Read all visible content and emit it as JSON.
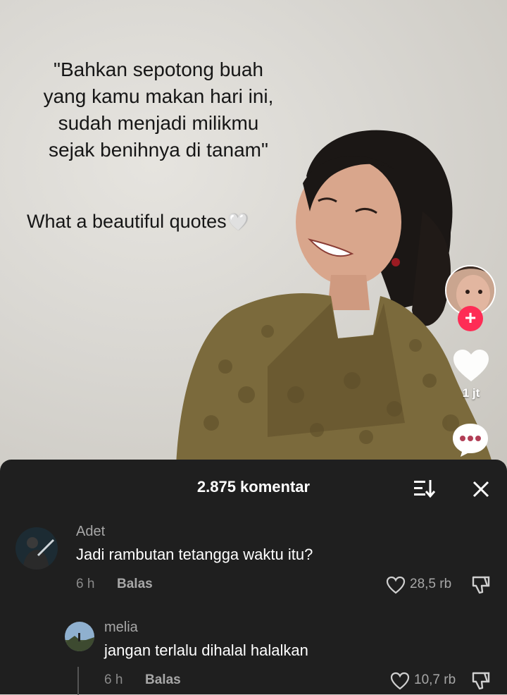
{
  "video": {
    "caption_quote": "\"Bahkan sepotong buah\nyang kamu makan hari ini,\nsudah menjadi milikmu\nsejak benihnya di tanam\"",
    "caption_comment": "What a beautiful quotes",
    "caption_emoji": "🤍"
  },
  "rail": {
    "follow_symbol": "+",
    "like_count": "1 jt",
    "like_icon": "heart-icon",
    "comment_icon": "comment-bubble-icon"
  },
  "comments_sheet": {
    "title": "2.875 komentar",
    "sort_icon": "sort-icon",
    "close_icon": "close-icon",
    "comments": [
      {
        "username": "Adet",
        "text": "Jadi rambutan tetangga waktu itu?",
        "time": "6 h",
        "reply_label": "Balas",
        "likes": "28,5 rb"
      },
      {
        "username": "melia",
        "text": "jangan terlalu dihalal halalkan",
        "time": "6 h",
        "reply_label": "Balas",
        "likes": "10,7 rb"
      }
    ]
  },
  "colors": {
    "accent": "#fe2c55",
    "sheet_bg": "#1f1f1f",
    "text_primary": "#ffffff",
    "text_secondary": "#a7a7a7"
  }
}
